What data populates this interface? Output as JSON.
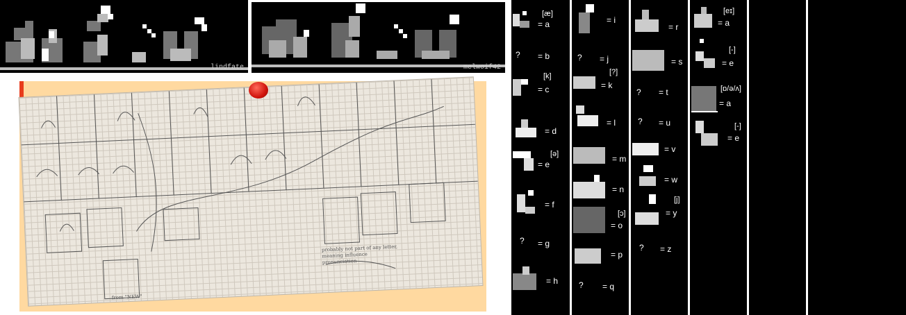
{
  "panels": {
    "left_credit": "lindfate",
    "right_credit": "melwoif42"
  },
  "key": {
    "col1": [
      {
        "ipa": "[æ]",
        "letter": "= a"
      },
      {
        "unknown": "?",
        "letter": "= b"
      },
      {
        "ipa": "[k]",
        "letter": "= c"
      },
      {
        "letter": "= d"
      },
      {
        "ipa": "[ə]",
        "letter": "= e"
      },
      {
        "letter": "= f"
      },
      {
        "unknown": "?",
        "letter": "= g"
      },
      {
        "letter": "= h"
      }
    ],
    "col2": [
      {
        "letter": "= i"
      },
      {
        "unknown": "?",
        "letter": "= j"
      },
      {
        "ipa": "[?]",
        "letter": "= k"
      },
      {
        "letter": "= l"
      },
      {
        "letter": "= m"
      },
      {
        "letter": "= n"
      },
      {
        "ipa": "[ɔ]",
        "letter": "= o"
      },
      {
        "letter": "= p"
      },
      {
        "unknown": "?",
        "letter": "= q"
      }
    ],
    "col3": [
      {
        "letter": "= r"
      },
      {
        "letter": "= s"
      },
      {
        "unknown": "?",
        "letter": "= t"
      },
      {
        "unknown": "?",
        "letter": "= u"
      },
      {
        "letter": "= v"
      },
      {
        "letter": "= w"
      },
      {
        "ipa": "[j]",
        "letter": "= y"
      },
      {
        "unknown": "?",
        "letter": "= z"
      }
    ],
    "col4": [
      {
        "ipa": "[eɪ]",
        "letter": "= a"
      },
      {
        "ipa": "[-]",
        "letter": "= e"
      },
      {
        "ipa": "[ɒ/ə/ʌ]",
        "letter": "= a"
      },
      {
        "ipa": "[-]",
        "letter": "= e"
      }
    ]
  },
  "notebook": {
    "note_probably": "probably not part of any letter, meaning influence pronunciation",
    "note_new": "from \"NEW\""
  },
  "colors": {
    "black": "#000000",
    "paper": "#ece7de",
    "sticky": "#ffd9a0",
    "pin": "#d0140c"
  }
}
